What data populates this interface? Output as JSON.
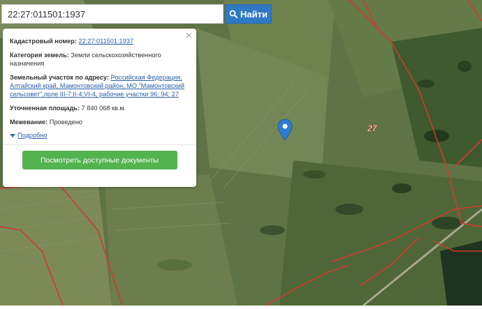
{
  "search": {
    "value": "22:27:011501:1937",
    "button_label": "Найти"
  },
  "popup": {
    "cadastral_label": "Кадастровый номер:",
    "cadastral_value": "22:27:011501:1937",
    "category_label": "Категория земель:",
    "category_value": "Земли сельскохозяйственного назначения",
    "address_label": "Земельный участок по адресу:",
    "address_value": "Российская Федерация, Алтайский край, Мамонтовский район, МО \"Мамонтовский сельсовет\",поле III-7;II-4;VI-4, рабочие участки 96; 94; 27",
    "area_label": "Уточненная площадь:",
    "area_value": "7 840 068 кв.м.",
    "survey_label": "Межевание:",
    "survey_value": "Проведено",
    "more_label": "Подробно",
    "docs_button_label": "Посмотреть доступные документы"
  },
  "map": {
    "parcel_label": "27"
  },
  "colors": {
    "boundary": "#d23a2e",
    "accent": "#2f78c4",
    "docs_button": "#52b34f",
    "marker": "#2f7dd2"
  },
  "icons": {
    "search": "search-icon",
    "close": "close-icon",
    "marker": "map-marker-icon",
    "expand": "triangle-down-icon"
  }
}
